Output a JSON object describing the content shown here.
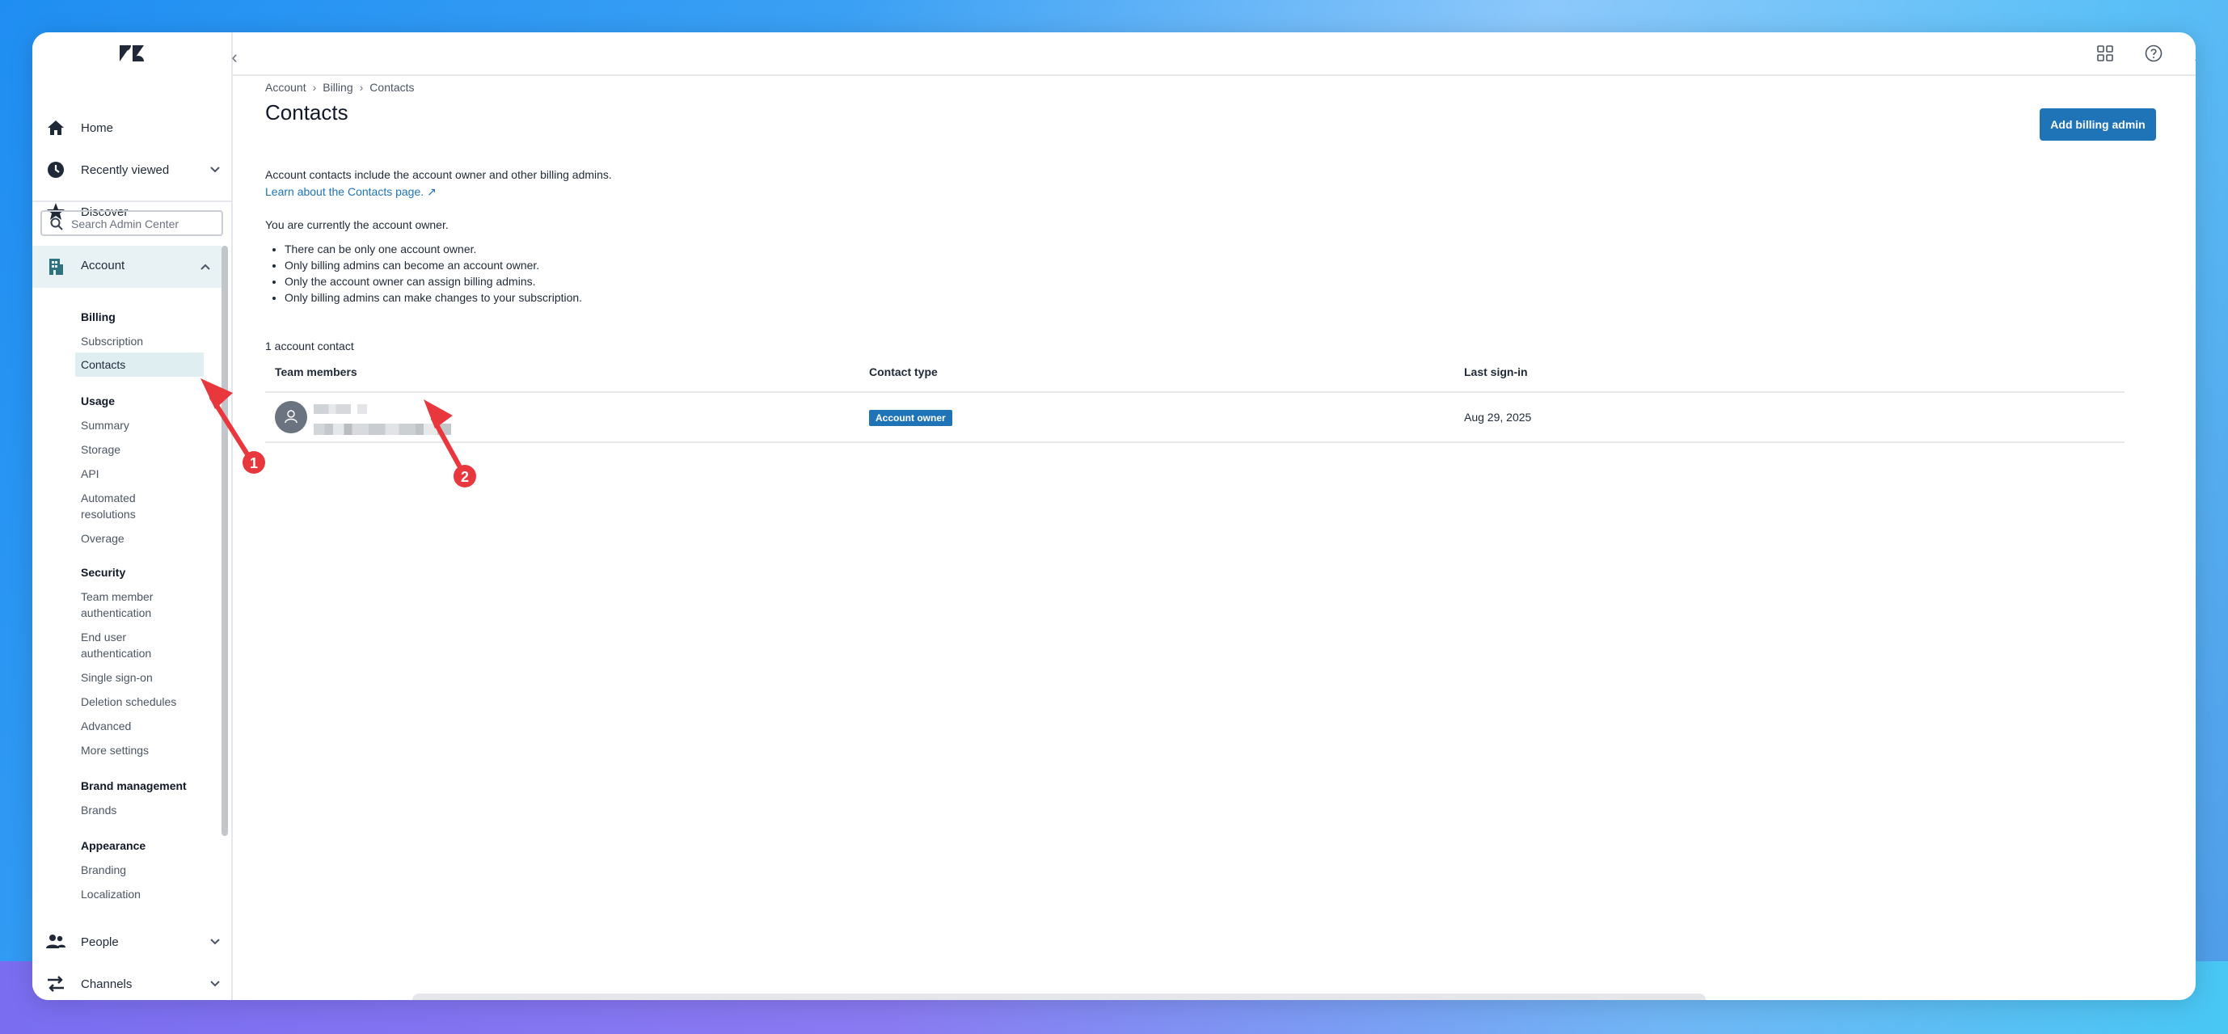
{
  "sidebar": {
    "nav_top": [
      {
        "label": "Home",
        "icon": "home-icon"
      },
      {
        "label": "Recently viewed",
        "icon": "clock-icon"
      },
      {
        "label": "Discover",
        "icon": "star-icon"
      }
    ],
    "search": {
      "placeholder": "Search Admin Center"
    },
    "account": {
      "label": "Account",
      "icon": "building-icon"
    },
    "groups": [
      {
        "title": "Billing",
        "items": [
          "Subscription",
          "Contacts"
        ]
      },
      {
        "title": "Usage",
        "items": [
          "Summary",
          "Storage",
          "API",
          "Automated resolutions",
          "Overage"
        ]
      },
      {
        "title": "Security",
        "items": [
          "Team member authentication",
          "End user authentication",
          "Single sign-on",
          "Deletion schedules",
          "Advanced",
          "More settings"
        ]
      },
      {
        "title": "Brand management",
        "items": [
          "Brands"
        ]
      },
      {
        "title": "Appearance",
        "items": [
          "Branding",
          "Localization"
        ]
      }
    ],
    "active_item": "Contacts",
    "nav_bottom": [
      {
        "label": "People",
        "icon": "people-icon"
      },
      {
        "label": "Channels",
        "icon": "channels-icon"
      }
    ]
  },
  "topbar": {
    "icons": [
      "apps-grid-icon",
      "help-icon",
      "user-icon"
    ]
  },
  "breadcrumb": [
    "Account",
    "Billing",
    "Contacts"
  ],
  "page": {
    "title": "Contacts",
    "description": "Account contacts include the account owner and other billing admins.",
    "learn_link": "Learn about the Contacts page.",
    "owner_note": "You are currently the account owner.",
    "rules": [
      "There can be only one account owner.",
      "Only billing admins can become an account owner.",
      "Only the account owner can assign billing admins.",
      "Only billing admins can make changes to your subscription."
    ],
    "add_button": "Add billing admin",
    "count": "1 account contact"
  },
  "table": {
    "headers": [
      "Team members",
      "Contact type",
      "Last sign-in"
    ],
    "rows": [
      {
        "contact_type": "Account owner",
        "last_sign_in": "Aug 29, 2025"
      }
    ]
  },
  "annotations": [
    "1",
    "2"
  ],
  "colors": {
    "primary": "#1f73b7",
    "annotation": "#e8383d",
    "active_bg": "#dfeff1"
  }
}
